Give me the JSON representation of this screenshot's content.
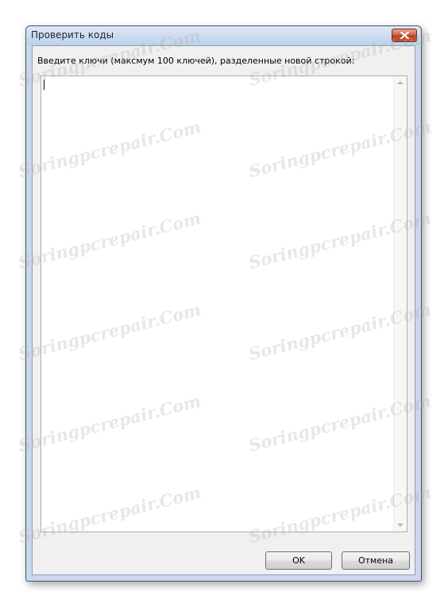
{
  "window": {
    "title": "Проверить коды",
    "close_icon": "close-icon"
  },
  "content": {
    "prompt": "Введите ключи (максмум 100 ключей), разделенные новой строкой:",
    "keys_value": ""
  },
  "buttons": {
    "ok_label": "OK",
    "cancel_label": "Отмена"
  },
  "watermark": {
    "text": "Soringpcrepair.Com"
  },
  "colors": {
    "frame": "#c9d8eb",
    "close_button": "#c85433",
    "client_background": "#f0f0f0"
  }
}
